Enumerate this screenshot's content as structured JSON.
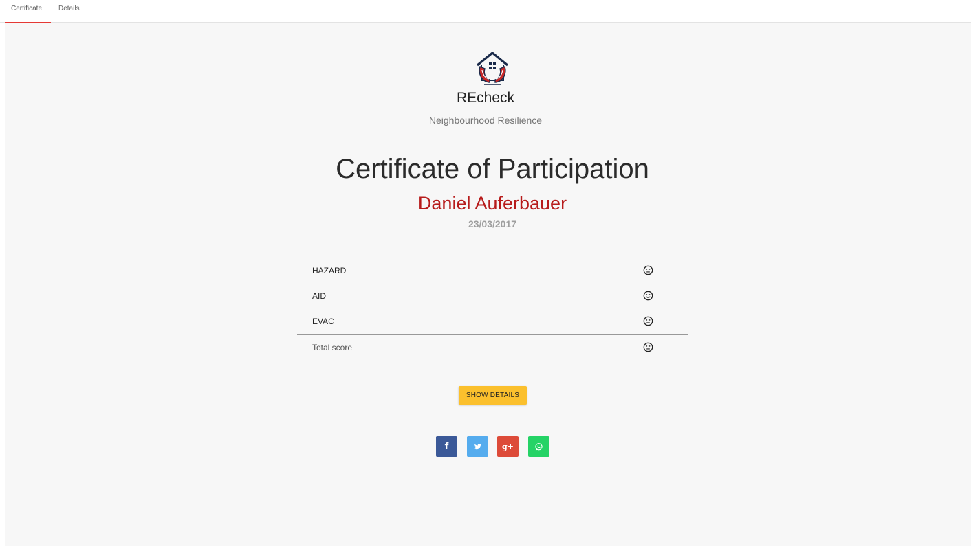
{
  "tabs": [
    {
      "label": "Certificate",
      "active": true
    },
    {
      "label": "Details",
      "active": false
    }
  ],
  "brand": {
    "name": "REcheck",
    "tagline": "Neighbourhood Resilience",
    "logo_icon": "house-hands-logo"
  },
  "certificate": {
    "title": "Certificate of Participation",
    "name": "Daniel Auferbauer",
    "date": "23/03/2017"
  },
  "scores": {
    "rows": [
      {
        "label": "HAZARD",
        "rating": "neutral-face-icon"
      },
      {
        "label": "AID",
        "rating": "happy-face-icon"
      },
      {
        "label": "EVAC",
        "rating": "neutral-face-icon"
      }
    ],
    "total": {
      "label": "Total score",
      "rating": "neutral-face-icon"
    }
  },
  "actions": {
    "show_details": "SHOW DETAILS"
  },
  "share": {
    "facebook": "f",
    "twitter": "twitter-icon",
    "googleplus": "g+",
    "whatsapp": "whatsapp-icon"
  },
  "colors": {
    "accent": "#e53935",
    "name": "#b71c1c",
    "button": "#fbc02d",
    "facebook": "#3b5998",
    "twitter": "#55acee",
    "googleplus": "#dd4b39",
    "whatsapp": "#25d366"
  }
}
